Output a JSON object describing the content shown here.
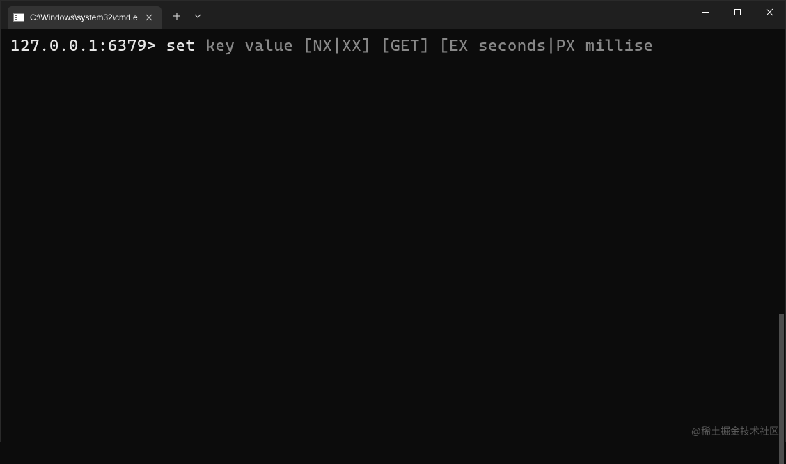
{
  "titlebar": {
    "tab_title": "C:\\Windows\\system32\\cmd.e",
    "close_tab": "✕",
    "new_tab": "＋"
  },
  "terminal": {
    "prompt": "127.0.0.1:6379> ",
    "command": "set",
    "hint": " key value [NX|XX] [GET] [EX seconds|PX millise"
  },
  "watermark": "@稀土掘金技术社区"
}
